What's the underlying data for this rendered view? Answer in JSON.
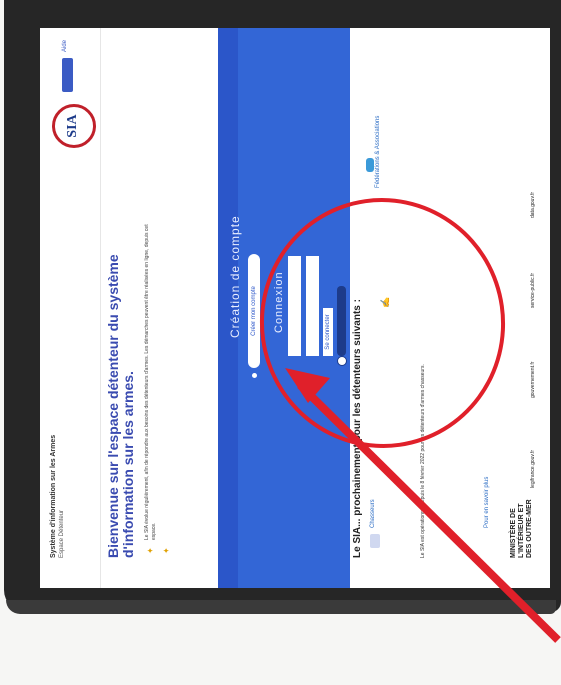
{
  "app": {
    "site_title": "Système d'information sur les Armes",
    "site_subtitle": "Espace Détenteur",
    "logo_text": "SIA",
    "help_label": "Aide"
  },
  "hero": {
    "headline": "Bienvenue sur l'espace détenteur du système d'information sur les armes.",
    "intro": "Le SIA évolue régulièrement, afin de répondre aux besoins des détenteurs d'armes. Les démarches peuvent être réalisées en ligne, depuis cet espace."
  },
  "account": {
    "create_title": "Création de compte",
    "create_button": "Créer mon compte",
    "login_title": "Connexion",
    "username_value": "",
    "password_value": "",
    "login_button": "Se connecter"
  },
  "partners": {
    "title": "Le SIA... prochainement pour les détenteurs suivants :",
    "partner_a": "Chasseurs",
    "partner_c": "Fédérations & Associations",
    "more_link": "Pour en savoir plus",
    "body": "Le SIA est opérationnel depuis le 8 février 2022 pour les détenteurs d'armes chasseurs."
  },
  "footer": {
    "ministry": "MINISTÈRE DE L'INTÉRIEUR ET DES OUTRE-MER",
    "links": [
      "legifrance.gouv.fr",
      "gouvernement.fr",
      "service-public.fr",
      "data.gouv.fr"
    ]
  },
  "annotation": {
    "color": "#e0202a"
  }
}
